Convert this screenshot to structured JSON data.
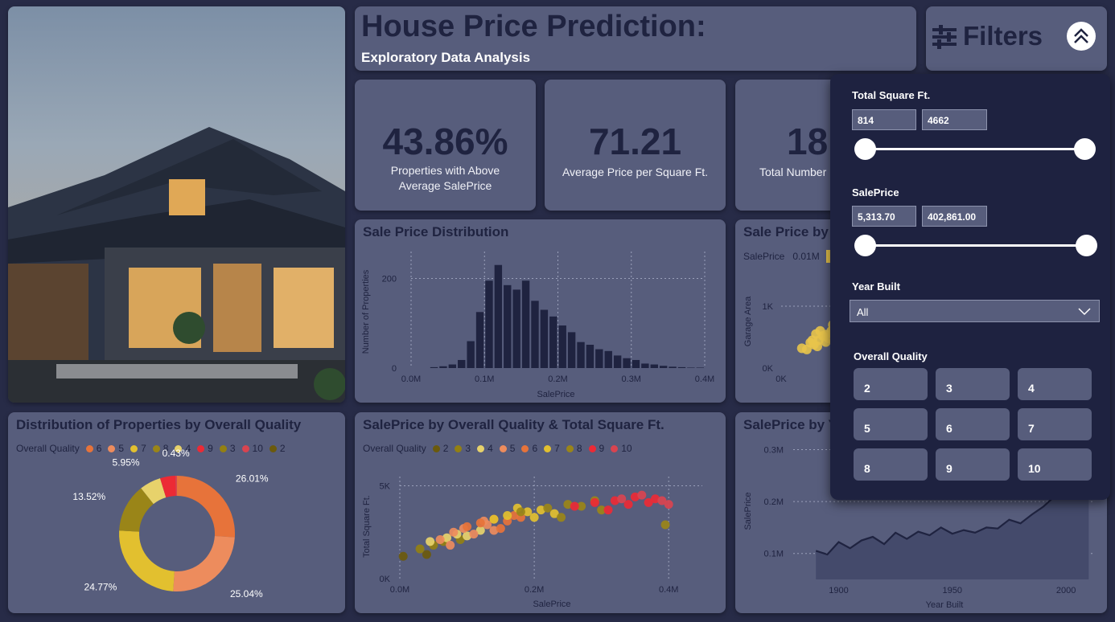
{
  "header": {
    "title": "House Price Prediction:",
    "subtitle": "Exploratory Data Analysis"
  },
  "filters_header": {
    "label": "Filters",
    "filter_icon": "sliders-icon",
    "collapse_icon": "double-chevron-up-icon"
  },
  "kpis": [
    {
      "value": "43.86%",
      "label": "Properties with Above Average SalePrice"
    },
    {
      "value": "71.21",
      "label": "Average Price per Square Ft."
    },
    {
      "value": "18",
      "label": "Total Number"
    }
  ],
  "filters": {
    "sqft": {
      "label": "Total Square Ft.",
      "min": "814",
      "max": "4662"
    },
    "saleprice": {
      "label": "SalePrice",
      "min": "5,313.70",
      "max": "402,861.00"
    },
    "year": {
      "label": "Year Built",
      "value": "All"
    },
    "quality": {
      "label": "Overall Quality",
      "options": [
        "2",
        "3",
        "4",
        "5",
        "6",
        "7",
        "8",
        "9",
        "10"
      ]
    }
  },
  "colors": {
    "q2": "#6b5a0c",
    "q3": "#938012",
    "q4": "#e7d26b",
    "q5": "#ed8c5d",
    "q6": "#e7733a",
    "q7": "#e2c02f",
    "q8": "#9a8518",
    "q9": "#ec2a35",
    "q10": "#d94450",
    "bar": "#1f2340",
    "accent_yellow": "#e8c44b"
  },
  "hist": {
    "title": "Sale Price Distribution",
    "chart_data": {
      "type": "bar",
      "xlabel": "SalePrice",
      "ylabel": "Number of Properties",
      "x_ticks": [
        "0.0M",
        "0.1M",
        "0.2M",
        "0.3M",
        "0.4M"
      ],
      "y_ticks": [
        "0",
        "200"
      ],
      "xlim": [
        0,
        400000
      ],
      "ylim": [
        0,
        260
      ],
      "bin_width": 12500,
      "bin_starts": [
        0,
        12500,
        25000,
        37500,
        50000,
        62500,
        75000,
        87500,
        100000,
        112500,
        125000,
        137500,
        150000,
        162500,
        175000,
        187500,
        200000,
        212500,
        225000,
        237500,
        250000,
        262500,
        275000,
        287500,
        300000,
        312500,
        325000,
        337500,
        350000,
        362500,
        375000,
        387500
      ],
      "values": [
        0,
        0,
        2,
        4,
        8,
        18,
        60,
        125,
        195,
        230,
        185,
        175,
        195,
        150,
        130,
        115,
        95,
        80,
        58,
        52,
        42,
        38,
        28,
        22,
        18,
        10,
        8,
        5,
        3,
        2,
        1,
        1
      ]
    }
  },
  "scatter_garage": {
    "title": "Sale Price by",
    "legend_label": "SalePrice",
    "legend_value": "0.01M",
    "chart_data": {
      "type": "scatter",
      "xlabel": "",
      "ylabel": "Garage Area",
      "x_ticks": [
        "0K"
      ],
      "y_ticks": [
        "0K",
        "1K"
      ],
      "points": [
        [
          180,
          320
        ],
        [
          300,
          410
        ],
        [
          420,
          450
        ],
        [
          520,
          540
        ],
        [
          600,
          600
        ],
        [
          700,
          650
        ],
        [
          350,
          380
        ],
        [
          250,
          300
        ],
        [
          480,
          520
        ],
        [
          620,
          700
        ],
        [
          560,
          480
        ],
        [
          400,
          350
        ],
        [
          330,
          450
        ],
        [
          440,
          600
        ],
        [
          680,
          520
        ],
        [
          520,
          420
        ],
        [
          380,
          550
        ],
        [
          610,
          560
        ]
      ]
    }
  },
  "donut": {
    "title": "Distribution of Properties by Overall Quality",
    "legend_label": "Overall Quality",
    "legend": [
      "6",
      "5",
      "7",
      "8",
      "4",
      "9",
      "3",
      "10",
      "2"
    ],
    "chart_data": {
      "type": "pie",
      "slices": [
        {
          "label": "6",
          "value": 26.01,
          "text": "26.01%"
        },
        {
          "label": "5",
          "value": 25.04,
          "text": "25.04%"
        },
        {
          "label": "7",
          "value": 24.77,
          "text": "24.77%"
        },
        {
          "label": "8",
          "value": 13.52,
          "text": "13.52%"
        },
        {
          "label": "4",
          "value": 5.95,
          "text": "5.95%"
        },
        {
          "label": "9",
          "value": 4.28,
          "text": ""
        },
        {
          "label": "3",
          "value": 0.0,
          "text": ""
        },
        {
          "label": "10",
          "value": 0.43,
          "text": "0.43%"
        }
      ]
    }
  },
  "scatter_sqft": {
    "title": "SalePrice by Overall Quality & Total Square Ft.",
    "legend_label": "Overall Quality",
    "legend": [
      "2",
      "3",
      "4",
      "5",
      "6",
      "7",
      "8",
      "9",
      "10"
    ],
    "chart_data": {
      "type": "scatter",
      "xlabel": "SalePrice",
      "ylabel": "Total Square Ft.",
      "x_ticks": [
        "0.0M",
        "0.2M",
        "0.4M"
      ],
      "y_ticks": [
        "0K",
        "5K"
      ],
      "xlim": [
        0,
        450000
      ],
      "ylim": [
        0,
        5500
      ],
      "series": [
        {
          "name": "2",
          "points": [
            [
              5000,
              1200
            ],
            [
              40000,
              1300
            ]
          ]
        },
        {
          "name": "3",
          "points": [
            [
              30000,
              1600
            ],
            [
              50000,
              1800
            ],
            [
              65000,
              2000
            ],
            [
              90000,
              2100
            ]
          ]
        },
        {
          "name": "4",
          "points": [
            [
              45000,
              2000
            ],
            [
              70000,
              2200
            ],
            [
              85000,
              2400
            ],
            [
              100000,
              2300
            ],
            [
              120000,
              2600
            ]
          ]
        },
        {
          "name": "5",
          "points": [
            [
              60000,
              2100
            ],
            [
              80000,
              2500
            ],
            [
              95000,
              2700
            ],
            [
              110000,
              2400
            ],
            [
              130000,
              2900
            ],
            [
              140000,
              2600
            ],
            [
              75000,
              1800
            ],
            [
              125000,
              3100
            ]
          ]
        },
        {
          "name": "6",
          "points": [
            [
              100000,
              2800
            ],
            [
              120000,
              3000
            ],
            [
              140000,
              3200
            ],
            [
              160000,
              3100
            ],
            [
              170000,
              3400
            ],
            [
              150000,
              2700
            ],
            [
              180000,
              3300
            ]
          ]
        },
        {
          "name": "7",
          "points": [
            [
              140000,
              3200
            ],
            [
              160000,
              3400
            ],
            [
              190000,
              3600
            ],
            [
              200000,
              3300
            ],
            [
              210000,
              3700
            ],
            [
              230000,
              3500
            ],
            [
              175000,
              3800
            ]
          ]
        },
        {
          "name": "8",
          "points": [
            [
              180000,
              3600
            ],
            [
              220000,
              3800
            ],
            [
              250000,
              4000
            ],
            [
              270000,
              3900
            ],
            [
              290000,
              4200
            ],
            [
              300000,
              3700
            ],
            [
              240000,
              3300
            ],
            [
              395000,
              2900
            ]
          ]
        },
        {
          "name": "9",
          "points": [
            [
              260000,
              3900
            ],
            [
              290000,
              4100
            ],
            [
              320000,
              4200
            ],
            [
              340000,
              4000
            ],
            [
              350000,
              4400
            ],
            [
              370000,
              4100
            ],
            [
              380000,
              4300
            ],
            [
              310000,
              3700
            ]
          ]
        },
        {
          "name": "10",
          "points": [
            [
              330000,
              4300
            ],
            [
              360000,
              4500
            ],
            [
              390000,
              4200
            ],
            [
              400000,
              4000
            ]
          ]
        }
      ]
    }
  },
  "year_line": {
    "title": "SalePrice by Y",
    "chart_data": {
      "type": "area",
      "xlabel": "Year Built",
      "ylabel": "SalePrice",
      "x_ticks": [
        "1900",
        "1950",
        "2000"
      ],
      "y_ticks": [
        "0.1M",
        "0.2M",
        "0.3M"
      ],
      "xlim": [
        1880,
        2012
      ],
      "ylim": [
        50000,
        310000
      ],
      "x": [
        1890,
        1895,
        1900,
        1905,
        1910,
        1915,
        1920,
        1925,
        1930,
        1935,
        1940,
        1945,
        1950,
        1955,
        1960,
        1965,
        1970,
        1975,
        1980,
        1985,
        1990,
        1995,
        2000,
        2005,
        2010
      ],
      "values": [
        105000,
        98000,
        122000,
        110000,
        125000,
        132000,
        118000,
        140000,
        128000,
        142000,
        135000,
        150000,
        138000,
        145000,
        140000,
        150000,
        148000,
        165000,
        158000,
        175000,
        190000,
        210000,
        220000,
        255000,
        215000
      ]
    }
  }
}
